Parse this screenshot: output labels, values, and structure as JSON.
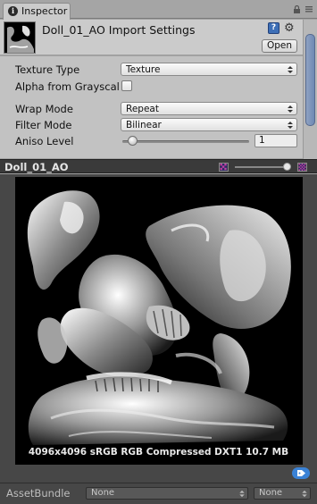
{
  "tab": {
    "label": "Inspector"
  },
  "header": {
    "title": "Doll_01_AO Import Settings",
    "open_label": "Open"
  },
  "settings": {
    "texture_type": {
      "label": "Texture Type",
      "value": "Texture"
    },
    "alpha_from_grayscale": {
      "label": "Alpha from Grayscal",
      "checked": false
    },
    "wrap_mode": {
      "label": "Wrap Mode",
      "value": "Repeat"
    },
    "filter_mode": {
      "label": "Filter Mode",
      "value": "Bilinear"
    },
    "aniso_level": {
      "label": "Aniso Level",
      "value": "1"
    }
  },
  "preview": {
    "title": "Doll_01_AO",
    "info": "4096x4096 sRGB  RGB Compressed DXT1   10.7 MB"
  },
  "asset_bundle": {
    "label": "AssetBundle",
    "name_value": "None",
    "variant_value": "None"
  },
  "colors": {
    "accent": "#3a82d6",
    "scroll_thumb": "#7c93ba"
  }
}
